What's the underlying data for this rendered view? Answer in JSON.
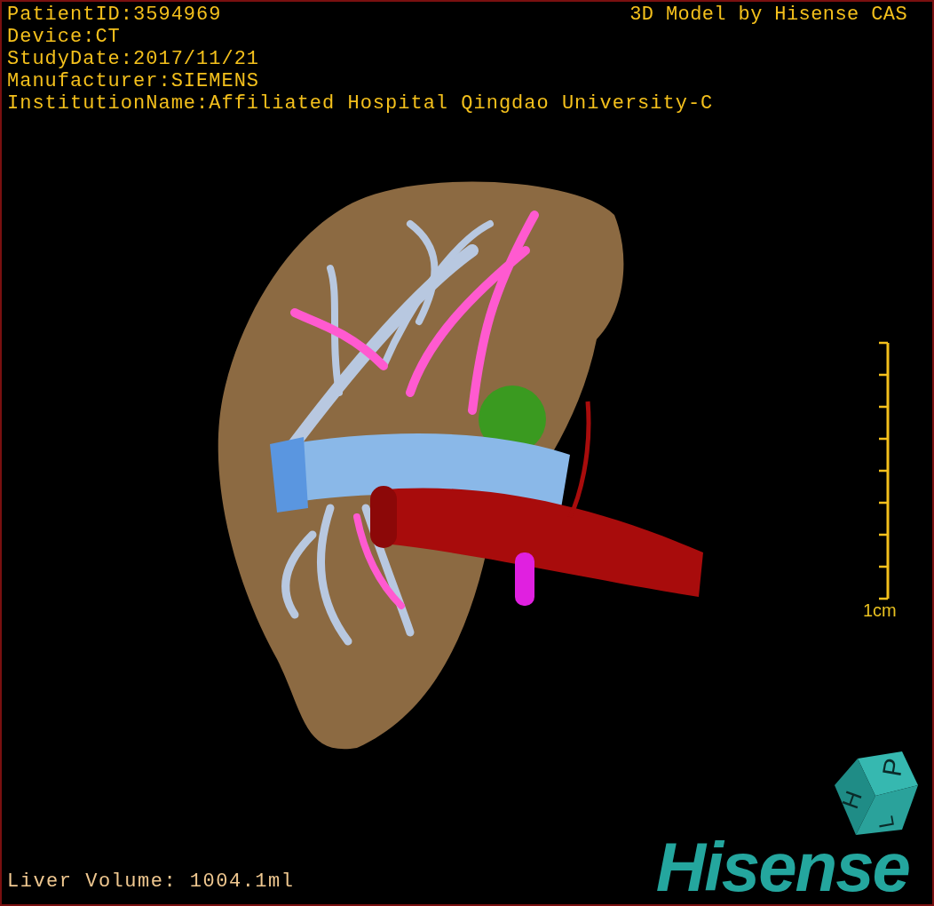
{
  "patient_info": [
    "PatientID:3594969",
    "Device:CT",
    "StudyDate:2017/11/21",
    "Manufacturer:SIEMENS",
    "InstitutionName:Affiliated Hospital Qingdao University-C"
  ],
  "model_credit": "3D Model by Hisense CAS",
  "scale_bar": {
    "label": "1cm"
  },
  "orientation_cube": {
    "faces": [
      "P",
      "H",
      "L"
    ]
  },
  "liver_volume": "Liver Volume: 1004.1ml",
  "logo": "Hisense"
}
